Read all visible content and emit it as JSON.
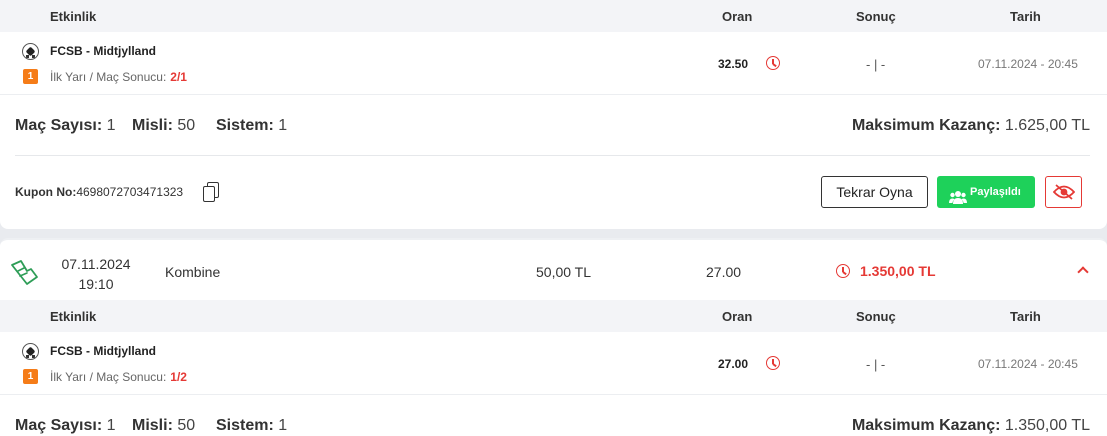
{
  "columns": {
    "event": "Etkinlik",
    "odds": "Oran",
    "result": "Sonuç",
    "date": "Tarih"
  },
  "coupon1": {
    "event": {
      "match": "FCSB - Midtjylland",
      "badge": "1",
      "market": "İlk Yarı / Maç Sonucu:",
      "pick": "2/1",
      "odds": "32.50",
      "result": "- | -",
      "date": "07.11.2024 - 20:45"
    },
    "summary": {
      "mac_label": "Maç Sayısı:",
      "mac_value": "1",
      "misli_label": "Misli:",
      "misli_value": "50",
      "sistem_label": "Sistem:",
      "sistem_value": "1",
      "max_label": "Maksimum Kazanç:",
      "max_value": "1.625,00 TL"
    },
    "kupon_label": "Kupon No:",
    "kupon_no": "4698072703471323",
    "buttons": {
      "replay": "Tekrar Oyna",
      "shared": "Paylaşıldı"
    }
  },
  "coupon2": {
    "date": "07.11.2024",
    "time": "19:10",
    "type": "Kombine",
    "stake": "50,00 TL",
    "total_odds": "27.00",
    "winnings": "1.350,00 TL",
    "event": {
      "match": "FCSB - Midtjylland",
      "badge": "1",
      "market": "İlk Yarı / Maç Sonucu:",
      "pick": "1/2",
      "odds": "27.00",
      "result": "- | -",
      "date": "07.11.2024 - 20:45"
    },
    "summary": {
      "mac_label": "Maç Sayısı:",
      "mac_value": "1",
      "misli_label": "Misli:",
      "misli_value": "50",
      "sistem_label": "Sistem:",
      "sistem_value": "1",
      "max_label": "Maksimum Kazanç:",
      "max_value": "1.350,00 TL"
    }
  },
  "colors": {
    "accent_red": "#e53935",
    "shared_green": "#1ed15a",
    "badge_orange": "#f57c18"
  },
  "icons": [
    "football-icon",
    "clock-icon",
    "copy-icon",
    "users-icon",
    "eye-icon",
    "ticket-logo-icon",
    "chevron-up-icon"
  ]
}
